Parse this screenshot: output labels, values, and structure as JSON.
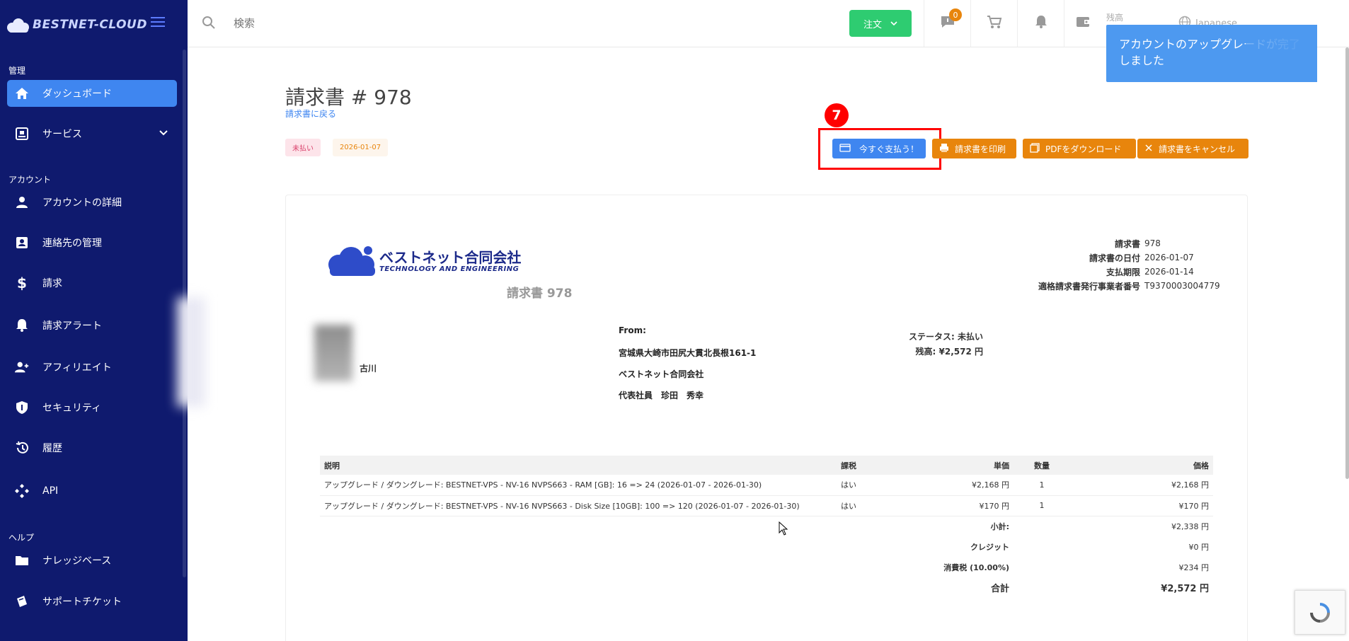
{
  "sidebar": {
    "brand": "BESTNET-CLOUD",
    "sections": {
      "manage": "管理",
      "account": "アカウント",
      "help": "ヘルプ"
    },
    "items": [
      {
        "label": "ダッシュボード",
        "icon": "home-icon"
      },
      {
        "label": "サービス",
        "icon": "box-icon"
      },
      {
        "label": "アカウントの詳細",
        "icon": "person-icon"
      },
      {
        "label": "連絡先の管理",
        "icon": "contacts-icon"
      },
      {
        "label": "請求",
        "icon": "dollar-icon"
      },
      {
        "label": "請求アラート",
        "icon": "bell-icon"
      },
      {
        "label": "アフィリエイト",
        "icon": "add-user-icon"
      },
      {
        "label": "セキュリティ",
        "icon": "shield-icon"
      },
      {
        "label": "履歴",
        "icon": "history-icon"
      },
      {
        "label": "API",
        "icon": "api-icon"
      },
      {
        "label": "ナレッジベース",
        "icon": "folder-icon"
      },
      {
        "label": "サポートチケット",
        "icon": "ticket-icon"
      }
    ]
  },
  "topbar": {
    "search_placeholder": "検索",
    "order_label": "注文",
    "messages_badge": "0",
    "balance_label": "残高",
    "language": "Japanese"
  },
  "toast": {
    "message": "アカウントのアップグレードが完了しました"
  },
  "page": {
    "title": "請求書 # 978",
    "back_link": "請求書に戻る",
    "status_tag": "未払い",
    "date_tag": "2026-01-07",
    "step_number": "7",
    "actions": {
      "pay": "今すぐ支払う！",
      "print": "請求書を印刷",
      "pdf": "PDFをダウンロード",
      "cancel": "請求書をキャンセル"
    }
  },
  "invoice": {
    "company_name": "ベストネット合同会社",
    "company_tagline": "TECHNOLOGY AND ENGINEERING",
    "caption": "請求書 978",
    "meta": [
      {
        "key": "請求書",
        "value": "978"
      },
      {
        "key": "請求書の日付",
        "value": "2026-01-07"
      },
      {
        "key": "支払期限",
        "value": "2026-01-14"
      },
      {
        "key": "適格請求書発行事業者番号",
        "value": "T9370003004779"
      }
    ],
    "client_name_partial": "古川",
    "from": {
      "label": "From:",
      "address": "宮城県大崎市田尻大貫北長根161-1",
      "company": "ベストネット合同会社",
      "representative": "代表社員　珍田　秀幸"
    },
    "status": {
      "status_line": "ステータス: 未払い",
      "balance_line": "残高: ¥2,572 円"
    },
    "table": {
      "headers": {
        "description": "説明",
        "tax": "課税",
        "unit_price": "単価",
        "qty": "数量",
        "price": "価格"
      },
      "rows": [
        {
          "description": "アップグレード / ダウングレード: BESTNET-VPS - NV-16 NVPS663 - RAM [GB]: 16 => 24 (2026-01-07 - 2026-01-30)",
          "tax": "はい",
          "unit_price": "¥2,168 円",
          "qty": "1",
          "price": "¥2,168 円"
        },
        {
          "description": "アップグレード / ダウングレード: BESTNET-VPS - NV-16 NVPS663 - Disk Size [10GB]: 100 => 120 (2026-01-07 - 2026-01-30)",
          "tax": "はい",
          "unit_price": "¥170 円",
          "qty": "1",
          "price": "¥170 円"
        }
      ],
      "summary": [
        {
          "label": "小計:",
          "value": "¥2,338 円"
        },
        {
          "label": "クレジット",
          "value": "¥0 円"
        },
        {
          "label": "消費税 (10.00%)",
          "value": "¥234 円"
        },
        {
          "label": "合計",
          "value": "¥2,572 円"
        }
      ]
    }
  },
  "colors": {
    "sidebar_bg": "#0f1a6e",
    "primary": "#3f86f0",
    "orange": "#e8850c",
    "green": "#2ecc71",
    "highlight_red": "#ff0000"
  }
}
